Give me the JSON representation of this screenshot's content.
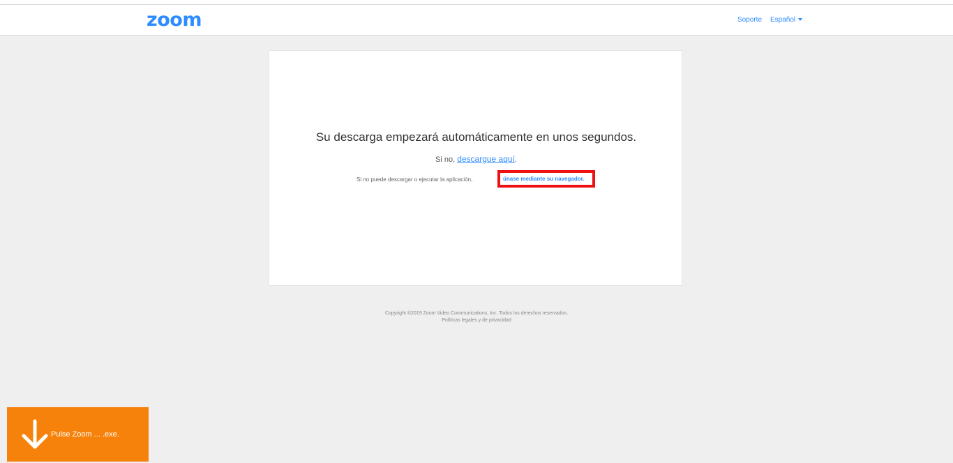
{
  "header": {
    "logo": "zoom",
    "support_label": "Soporte",
    "language_label": "Español"
  },
  "card": {
    "headline": "Su descarga empezará automáticamente en unos segundos.",
    "fallback_prefix": "Si no, ",
    "fallback_link": "descargue aquí",
    "fallback_suffix": ".",
    "browser_prefix": "Si no puede descargar o ejecutar la aplicación,",
    "browser_link": "únase mediante su navegador."
  },
  "footer": {
    "copyright": "Copyright ©2019 Zoom Video Communications, Inc. Todos los derechos reservados.",
    "legal": "Políticas legales y de privacidad"
  },
  "download_toast": {
    "text": "Pulse Zoom ... .exe.",
    "icon": "arrow-down-icon"
  },
  "colors": {
    "brand": "#2d8cff",
    "toast": "#f7820b",
    "highlight": "#ee1111"
  }
}
